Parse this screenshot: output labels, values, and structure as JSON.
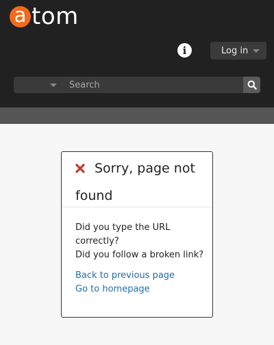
{
  "header": {
    "logo": {
      "first_letter": "a",
      "rest": "tom"
    },
    "login_label": "Log in",
    "search": {
      "placeholder": "Search",
      "value": ""
    }
  },
  "error_panel": {
    "title": "Sorry, page not found",
    "lines": [
      "Did you type the URL correctly?",
      "Did you follow a broken link?"
    ],
    "links": {
      "back": "Back to previous page",
      "home": "Go to homepage"
    }
  },
  "colors": {
    "header_bg": "#212121",
    "logo_accent": "#f26b1d",
    "error_icon": "#c0392b",
    "link": "#1f6fa8"
  },
  "icons": {
    "info": "info-icon",
    "search": "search-icon",
    "error": "close-icon"
  }
}
